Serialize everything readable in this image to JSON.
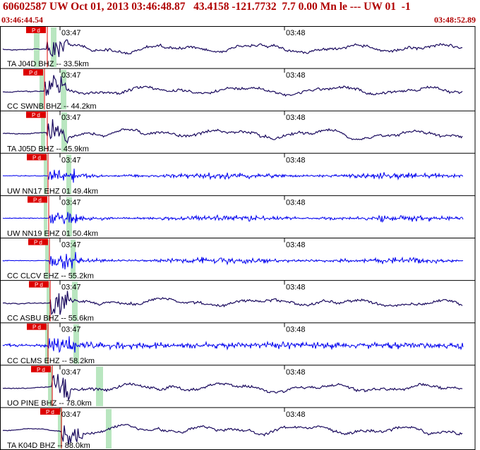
{
  "header": {
    "title": "60602587 UW Oct 01, 2013 03:46:48.87   43.4158 -121.7732  7.7 0.00 Mn le --- UW 01  -1",
    "start_time": "03:46:44.54",
    "end_time": "03:48:52.89"
  },
  "colors": {
    "header_red": "#b00000",
    "pick_red": "#dd0000",
    "trace_navy": "#1a0a5e",
    "trace_blue": "#0000ee",
    "window_green": "#b9e6c0",
    "frame_black": "#000000"
  },
  "chart_data": {
    "type": "line",
    "time_ticks": [
      "03:47",
      "03:48"
    ],
    "pick_label": "P d",
    "traces": [
      {
        "label": "TA J04D BHZ -- 33.5km",
        "color": "navy"
      },
      {
        "label": "CC SWNB BHZ -- 44.2km",
        "color": "navy"
      },
      {
        "label": "TA J05D BHZ -- 45.9km",
        "color": "navy"
      },
      {
        "label": "UW NN17 EHZ 01 49.4km",
        "color": "blue"
      },
      {
        "label": "UW NN19 EHZ 01 50.4km",
        "color": "blue"
      },
      {
        "label": "CC CLCV EHZ -- 55.2km",
        "color": "blue"
      },
      {
        "label": "CC ASBU BHZ -- 55.6km",
        "color": "navy"
      },
      {
        "label": "CC CLMS EHZ -- 58.2km",
        "color": "blue"
      },
      {
        "label": "UO PINE BHZ -- 78.0km",
        "color": "navy"
      },
      {
        "label": "TA K04D BHZ -- 88.0km",
        "color": "navy"
      }
    ]
  }
}
